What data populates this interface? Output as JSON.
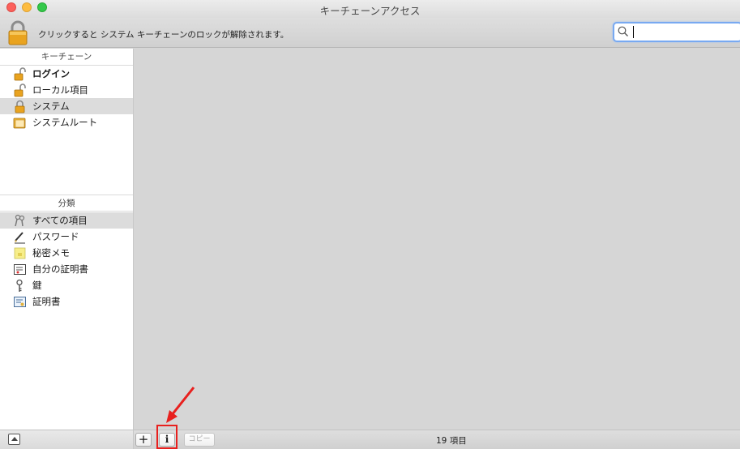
{
  "window": {
    "title": "キーチェーンアクセス"
  },
  "toolbar": {
    "lock_message": "クリックすると システム キーチェーンのロックが解除されます。",
    "search": {
      "value": "",
      "placeholder": ""
    }
  },
  "keychains": {
    "header": "キーチェーン",
    "items": [
      {
        "label": "ログイン",
        "icon": "lock-open-icon",
        "selected": false,
        "bold": true
      },
      {
        "label": "ローカル項目",
        "icon": "lock-open-icon",
        "selected": false,
        "bold": false
      },
      {
        "label": "システム",
        "icon": "lock-closed-icon",
        "selected": true,
        "bold": false
      },
      {
        "label": "システムルート",
        "icon": "folder-icon",
        "selected": false,
        "bold": false
      }
    ]
  },
  "categories": {
    "header": "分類",
    "items": [
      {
        "label": "すべての項目",
        "icon": "keys-icon",
        "selected": true
      },
      {
        "label": "パスワード",
        "icon": "pen-icon",
        "selected": false
      },
      {
        "label": "秘密メモ",
        "icon": "note-icon",
        "selected": false
      },
      {
        "label": "自分の証明書",
        "icon": "my-certificate-icon",
        "selected": false
      },
      {
        "label": "鍵",
        "icon": "key-icon",
        "selected": false
      },
      {
        "label": "証明書",
        "icon": "certificate-icon",
        "selected": false
      }
    ]
  },
  "footer": {
    "add_label": "+",
    "info_label": "i",
    "copy_label": "コピー",
    "item_count": "19 項目"
  },
  "colors": {
    "accent": "#78a9f1",
    "highlight": "#e8201e",
    "selection": "#dcdcdc"
  }
}
